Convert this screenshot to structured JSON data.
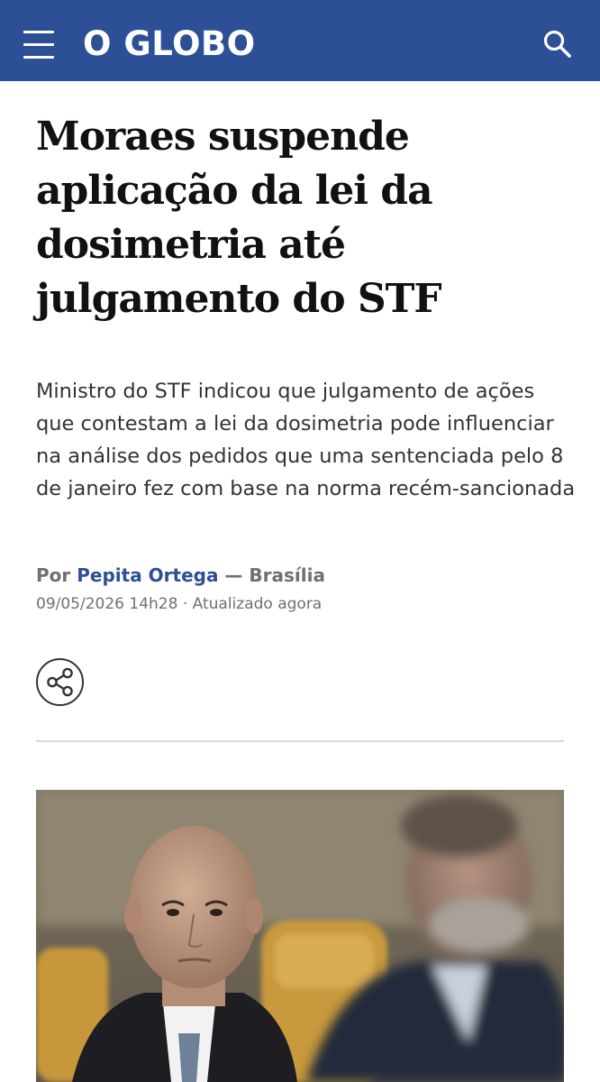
{
  "header": {
    "logo_text": "O GLOBO",
    "background_color": "#2d4f95",
    "menu_icon": "hamburger-menu-icon",
    "search_icon": "search-icon"
  },
  "article": {
    "headline": "Moraes suspende aplicação da lei da dosimetria até julgamento do STF",
    "subtitle": "Ministro do STF indicou que julgamento de ações que contestam a lei da dosimetria pode influenciar na análise dos pedidos que uma sentenciada pelo 8 de janeiro fez com base na norma recém-sancionada",
    "byline_prefix": "Por",
    "author": "Pepita Ortega",
    "location": "— Brasília",
    "date": "09/05/2026 14h28 · Atualizado agora",
    "share_icon": "share-icon",
    "accent_color": "#2d4f95"
  }
}
